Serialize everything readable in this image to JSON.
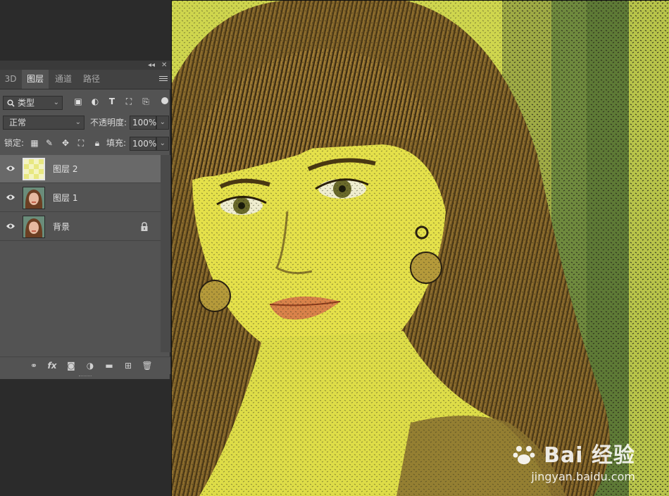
{
  "panel": {
    "tabs": [
      "3D",
      "图层",
      "通道",
      "路径"
    ],
    "active_tab": "图层",
    "filter": {
      "kind_label": "类型"
    },
    "blend": {
      "mode": "正常",
      "opacity_label": "不透明度:",
      "opacity_value": "100%"
    },
    "lock": {
      "label": "锁定:",
      "fill_label": "填充:",
      "fill_value": "100%"
    },
    "layers": [
      {
        "name": "图层 2",
        "selected": true,
        "thumb": "transparent-checker"
      },
      {
        "name": "图层 1",
        "selected": false,
        "thumb": "portrait"
      },
      {
        "name": "背景",
        "selected": false,
        "thumb": "portrait",
        "locked": true
      }
    ],
    "footer_icons": [
      "link-icon",
      "fx-icon",
      "mask-icon",
      "adjustment-icon",
      "folder-icon",
      "new-layer-icon",
      "trash-icon"
    ]
  },
  "watermark": {
    "brand": "Bai 经验",
    "url": "jingyan.baidu.com"
  },
  "colors": {
    "panel_bg": "#535353",
    "selected_row": "#696969",
    "workspace": "#2b2b2b"
  }
}
